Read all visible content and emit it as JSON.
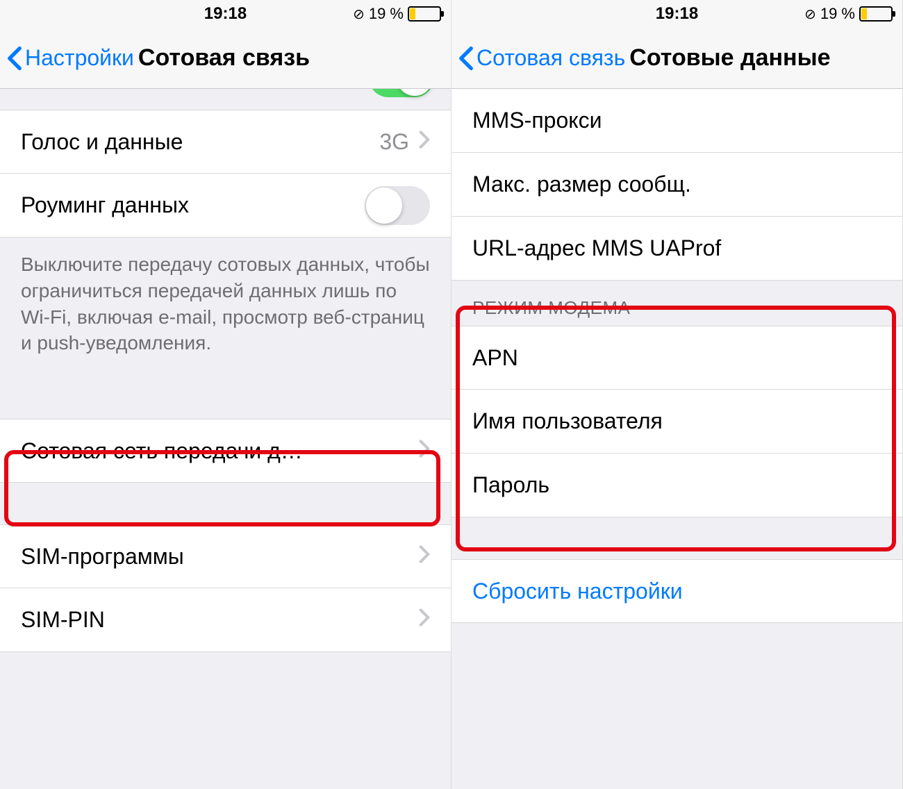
{
  "status": {
    "time": "19:18",
    "battery_percent": "19 %"
  },
  "left": {
    "back": "Настройки",
    "title": "Сотовая связь",
    "voice_data": {
      "label": "Голос и данные",
      "value": "3G"
    },
    "roaming": {
      "label": "Роуминг данных"
    },
    "footer": "Выключите передачу сотовых данных, чтобы ограничиться передачей данных лишь по Wi-Fi, включая e-mail, просмотр веб-страниц и push-уведомления.",
    "cellular_network": "Сотовая сеть передачи д…",
    "sim_apps": "SIM-программы",
    "sim_pin": "SIM-PIN"
  },
  "right": {
    "back": "Сотовая связь",
    "title": "Сотовые данные",
    "mms_proxy": "MMS-прокси",
    "max_msg_size": "Макс. размер сообщ.",
    "mms_uaprof": "URL-адрес MMS UAProf",
    "section_modem": "РЕЖИМ МОДЕМА",
    "apn": "APN",
    "username": "Имя пользователя",
    "password": "Пароль",
    "reset": "Сбросить настройки"
  }
}
